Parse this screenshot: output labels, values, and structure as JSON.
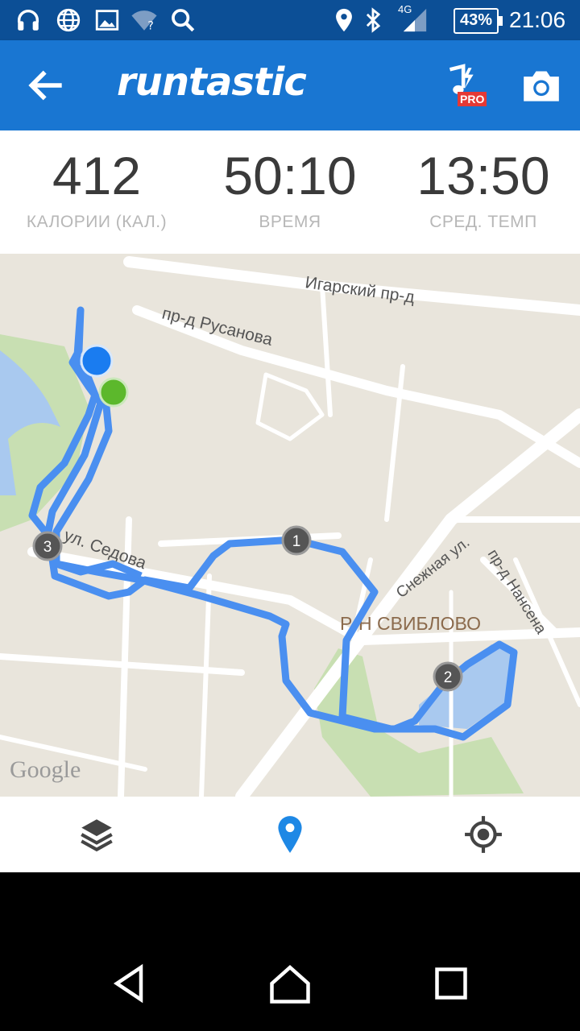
{
  "status_bar": {
    "battery": "43%",
    "time": "21:06",
    "network": "4G"
  },
  "app_bar": {
    "brand": "runtastic",
    "pro_badge": "PRO"
  },
  "stats": [
    {
      "value": "412",
      "label": "КАЛОРИИ (КАЛ.)"
    },
    {
      "value": "50:10",
      "label": "ВРЕМЯ"
    },
    {
      "value": "13:50",
      "label": "СРЕД. ТЕМП"
    }
  ],
  "map": {
    "streets": {
      "igarsky": "Игарский пр-д",
      "rusanova": "пр-д Русанова",
      "sedova": "ул. Седова",
      "snezhnaya": "Снежная ул.",
      "nansena": "пр-д Нансена"
    },
    "district": "Р-Н СВИБЛОВО",
    "google": "Google",
    "markers": [
      "1",
      "2",
      "3"
    ],
    "route_color": "#4a8ff0"
  },
  "icons": {
    "back": "arrow-left-icon",
    "music": "music-bolt-icon",
    "camera": "camera-icon",
    "layers": "layers-icon",
    "pin": "location-pin-icon",
    "locate": "my-location-icon"
  }
}
